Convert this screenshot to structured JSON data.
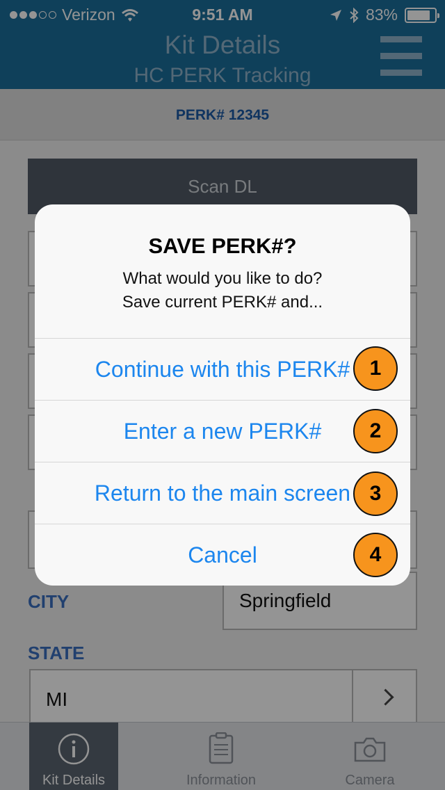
{
  "status_bar": {
    "carrier": "Verizon",
    "time": "9:51 AM",
    "battery": "83%",
    "battery_level": 0.83,
    "signal_bars": 3
  },
  "header": {
    "title": "Kit Details",
    "subtitle": "HC PERK Tracking",
    "menu_icon": "hamburger-icon"
  },
  "perk_bar": {
    "label": "PERK# 12345"
  },
  "content": {
    "scan_button": "Scan DL",
    "city_label": "CITY",
    "city_value": "Springfield",
    "state_label": "STATE",
    "state_value": "MI"
  },
  "tabbar": {
    "tabs": [
      {
        "label": "Kit Details",
        "icon": "info-icon",
        "active": true
      },
      {
        "label": "Information",
        "icon": "clipboard-icon",
        "active": false
      },
      {
        "label": "Camera",
        "icon": "camera-icon",
        "active": false
      }
    ]
  },
  "alert": {
    "title": "SAVE PERK#?",
    "message_line1": "What would you like to do?",
    "message_line2": "Save current PERK# and...",
    "buttons": [
      {
        "label": "Continue with this PERK#",
        "badge": "1"
      },
      {
        "label": "Enter a new PERK#",
        "badge": "2"
      },
      {
        "label": "Return to the main screen",
        "badge": "3"
      },
      {
        "label": "Cancel",
        "badge": "4"
      }
    ]
  },
  "colors": {
    "nav_bar": "#1a6e9b",
    "accent_blue": "#1c86ee",
    "label_blue": "#3a6fc0",
    "badge_orange": "#f7941d"
  }
}
